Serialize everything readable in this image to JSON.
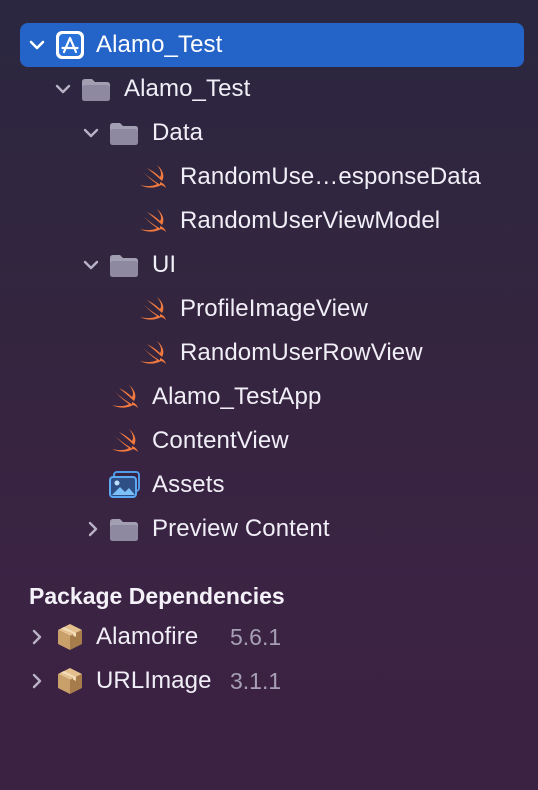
{
  "project": {
    "name": "Alamo_Test",
    "group": {
      "name": "Alamo_Test",
      "data_folder": "Data",
      "data_files": [
        "RandomUse…esponseData",
        "RandomUserViewModel"
      ],
      "ui_folder": "UI",
      "ui_files": [
        "ProfileImageView",
        "RandomUserRowView"
      ],
      "app_file": "Alamo_TestApp",
      "content_view": "ContentView",
      "assets": "Assets",
      "preview_content": "Preview Content"
    }
  },
  "package_dependencies": {
    "title": "Package Dependencies",
    "packages": [
      {
        "name": "Alamofire",
        "version": "5.6.1"
      },
      {
        "name": "URLImage",
        "version": "3.1.1"
      }
    ]
  },
  "colors": {
    "selection": "#2463C7",
    "swift_icon": "#F37A3E",
    "folder_icon": "#A39FB3",
    "package_icon": "#C99F6A",
    "version_text": "#A79FB6"
  },
  "icons": {
    "project": "xcode-project-icon",
    "folder": "folder-icon",
    "swift": "swift-file-icon",
    "assets": "asset-catalog-icon",
    "package": "package-icon",
    "disclosure_open": "chevron-down-icon",
    "disclosure_closed": "chevron-right-icon"
  }
}
